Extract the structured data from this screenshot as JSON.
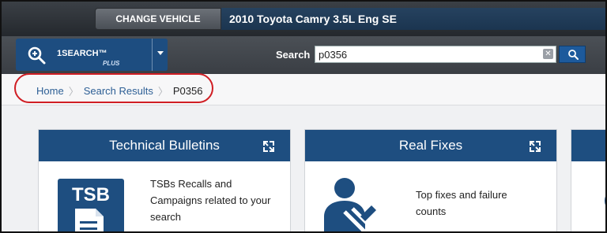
{
  "vehicle": {
    "change_label": "CHANGE VEHICLE",
    "name": "2010 Toyota Camry 3.5L Eng SE"
  },
  "search": {
    "product_name": "1SEARCH™",
    "product_suffix": "PLUS",
    "label": "Search",
    "value": "p0356",
    "clear_glyph": "✕"
  },
  "breadcrumb": {
    "items": [
      "Home",
      "Search Results"
    ],
    "current": "P0356"
  },
  "cards": [
    {
      "title": "Technical Bulletins",
      "icon": "tsb-icon",
      "icon_text": "TSB",
      "description_lines": [
        "TSBs Recalls and",
        "Campaigns related to your",
        "search"
      ]
    },
    {
      "title": "Real Fixes",
      "icon": "mechanic-icon",
      "description_lines": [
        "Top fixes and failure",
        "counts"
      ]
    }
  ],
  "colors": {
    "header_blue": "#1e4e80",
    "highlight": "#d01e24"
  }
}
